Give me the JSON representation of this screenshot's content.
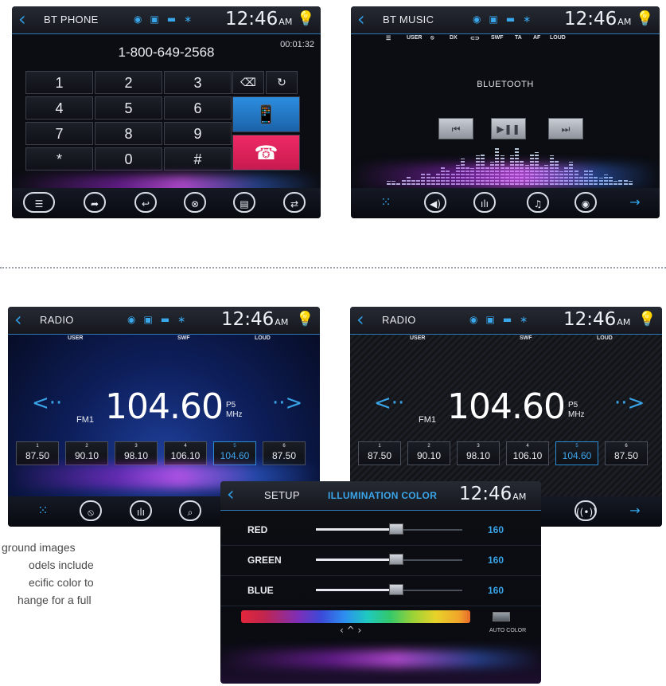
{
  "phone": {
    "title": "BT PHONE",
    "clock": "12:46",
    "ampm": "AM",
    "number": "1-800-649-2568",
    "timer": "00:01:32",
    "keys": [
      "1",
      "2",
      "3",
      "4",
      "5",
      "6",
      "7",
      "8",
      "9",
      "*",
      "0",
      "#"
    ]
  },
  "music": {
    "title": "BT MUSIC",
    "clock": "12:46",
    "ampm": "AM",
    "options": [
      "USER",
      "DX",
      "SWF",
      "TA",
      "AF",
      "LOUD"
    ],
    "source": "BLUETOOTH"
  },
  "radio1": {
    "title": "RADIO",
    "clock": "12:46",
    "ampm": "AM",
    "options": [
      "USER",
      "SWF",
      "LOUD"
    ],
    "band": "FM1",
    "frequency": "104.60",
    "preset_label": "P5",
    "unit": "MHz",
    "presets": [
      {
        "n": "1",
        "v": "87.50"
      },
      {
        "n": "2",
        "v": "90.10"
      },
      {
        "n": "3",
        "v": "98.10"
      },
      {
        "n": "4",
        "v": "106.10"
      },
      {
        "n": "5",
        "v": "104.60"
      },
      {
        "n": "6",
        "v": "87.50"
      }
    ]
  },
  "radio2": {
    "title": "RADIO",
    "clock": "12:46",
    "ampm": "AM",
    "options": [
      "USER",
      "SWF",
      "LOUD"
    ],
    "band": "FM1",
    "frequency": "104.60",
    "preset_label": "P5",
    "unit": "MHz",
    "presets": [
      {
        "n": "1",
        "v": "87.50"
      },
      {
        "n": "2",
        "v": "90.10"
      },
      {
        "n": "3",
        "v": "98.10"
      },
      {
        "n": "4",
        "v": "106.10"
      },
      {
        "n": "5",
        "v": "104.60"
      },
      {
        "n": "6",
        "v": "87.50"
      }
    ]
  },
  "setup": {
    "title": "SETUP",
    "subtitle": "ILLUMINATION COLOR",
    "clock": "12:46",
    "ampm": "AM",
    "sliders": [
      {
        "label": "RED",
        "value": "160",
        "level": 0.55
      },
      {
        "label": "GREEN",
        "value": "160",
        "level": 0.55
      },
      {
        "label": "BLUE",
        "value": "160",
        "level": 0.55
      }
    ],
    "auto_label": "AUTO COLOR"
  },
  "caption": {
    "line1": "ground images",
    "line2": "odels include",
    "line3": "ecific color to",
    "line4": "hange for a full"
  },
  "colors": {
    "accent_blue": "#2f9be0",
    "call_blue": "#1f78c8",
    "end_call_pink": "#e0225a",
    "bulb_yellow": "#f2c300"
  }
}
